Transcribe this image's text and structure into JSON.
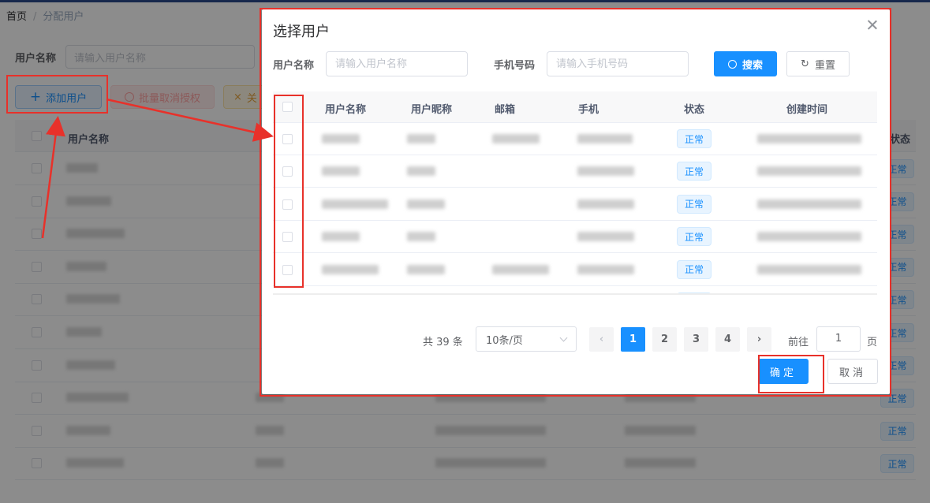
{
  "breadcrumb": {
    "home": "首页",
    "separator": "/",
    "current": "分配用户"
  },
  "background": {
    "search_label": "用户名称",
    "search_placeholder": "请输入用户名称",
    "add_user": "添加用户",
    "batch_cancel": "批量取消授权",
    "close_partial": "关",
    "col_username": "用户名称",
    "col_status": "状态",
    "status_tag": "正常"
  },
  "dialog": {
    "title": "选择用户",
    "query": {
      "username_label": "用户名称",
      "username_placeholder": "请输入用户名称",
      "phone_label": "手机号码",
      "phone_placeholder": "请输入手机号码",
      "search_button": "搜索",
      "reset_button": "重置"
    },
    "table": {
      "columns": [
        "用户名称",
        "用户昵称",
        "邮箱",
        "手机",
        "状态",
        "创建时间"
      ],
      "rows": [
        {
          "status": "正常"
        },
        {
          "status": "正常"
        },
        {
          "status": "正常"
        },
        {
          "status": "正常"
        },
        {
          "status": "正常"
        }
      ]
    },
    "pagination": {
      "total": "共 39 条",
      "page_size": "10条/页",
      "pages": [
        "1",
        "2",
        "3",
        "4"
      ],
      "current": "1",
      "goto_label": "前往",
      "goto_value": "1",
      "page_suffix": "页"
    },
    "ok_button": "确定",
    "cancel_button": "取消"
  },
  "colors": {
    "primary": "#1890ff",
    "annotation": "#e8312a"
  }
}
